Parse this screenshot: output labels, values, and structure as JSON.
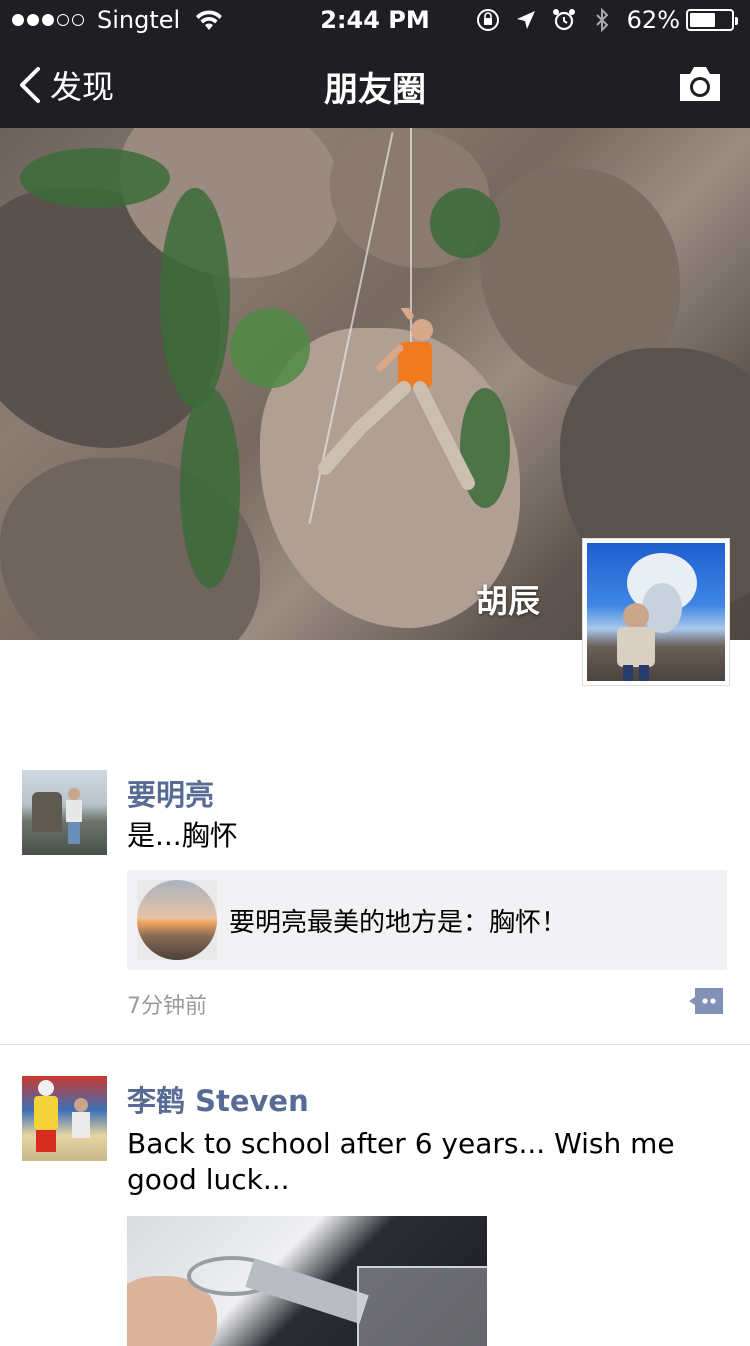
{
  "status_bar": {
    "carrier": "Singtel",
    "time": "2:44 PM",
    "battery_percent": "62%",
    "battery_level": 0.62,
    "signal_bars_filled": 3,
    "signal_bars_total": 5
  },
  "nav": {
    "back_label": "发现",
    "title": "朋友圈"
  },
  "cover": {
    "owner_name": "胡辰"
  },
  "posts": [
    {
      "author": "要明亮",
      "text": "是...胸怀",
      "link_title": "要明亮最美的地方是：胸怀！",
      "time": "7分钟前"
    },
    {
      "author": "李鹤 Steven",
      "text": "Back to school after 6 years... Wish me good luck..."
    }
  ],
  "colors": {
    "bar_background": "#1f1e23",
    "name_link": "#576b95",
    "card_background": "#f2f2f4",
    "time_gray": "#9a9a9a"
  },
  "icons": {
    "back": "chevron-left-icon",
    "camera": "camera-icon",
    "comment": "comment-icon",
    "wifi": "wifi-icon",
    "orientation_lock": "orientation-lock-icon",
    "location": "location-arrow-icon",
    "alarm": "alarm-icon",
    "bluetooth": "bluetooth-icon"
  }
}
